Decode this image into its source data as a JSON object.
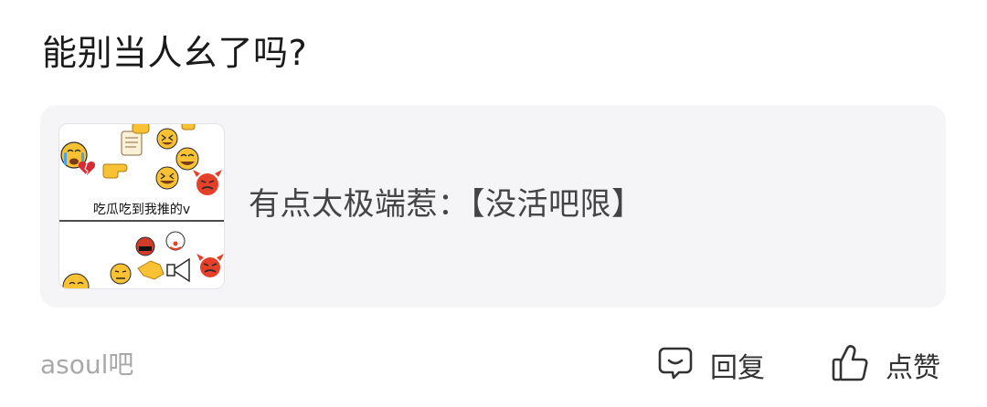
{
  "post": {
    "title": "能别当人幺了吗?"
  },
  "link_card": {
    "title": "有点太极端惹：【没活吧限】",
    "thumbnail": {
      "caption": "吃瓜吃到我推的v",
      "emojis_top": [
        "crying-face",
        "broken-heart",
        "scroll",
        "pointing-hand",
        "rolling-laughing-face",
        "grinning-squint-face",
        "laughing-face",
        "angry-devil-face",
        "raised-fist"
      ],
      "emojis_bottom": [
        "cursing-face",
        "clown-face",
        "megaphone",
        "angry-devil-face",
        "pointing-hand",
        "annoyed-face",
        "grinning-face"
      ]
    }
  },
  "footer": {
    "forum_name": "asoul吧",
    "reply_label": "回复",
    "like_label": "点赞",
    "reply_icon": "comment-bubble-icon",
    "like_icon": "thumbs-up-icon"
  },
  "colors": {
    "title": "#1a1a1a",
    "card_bg": "#f5f5f7",
    "card_text": "#444444",
    "forum_text": "#a8a8a8",
    "action_text": "#333333",
    "emoji_yellow": "#f9c235",
    "devil_red": "#e5402a"
  }
}
